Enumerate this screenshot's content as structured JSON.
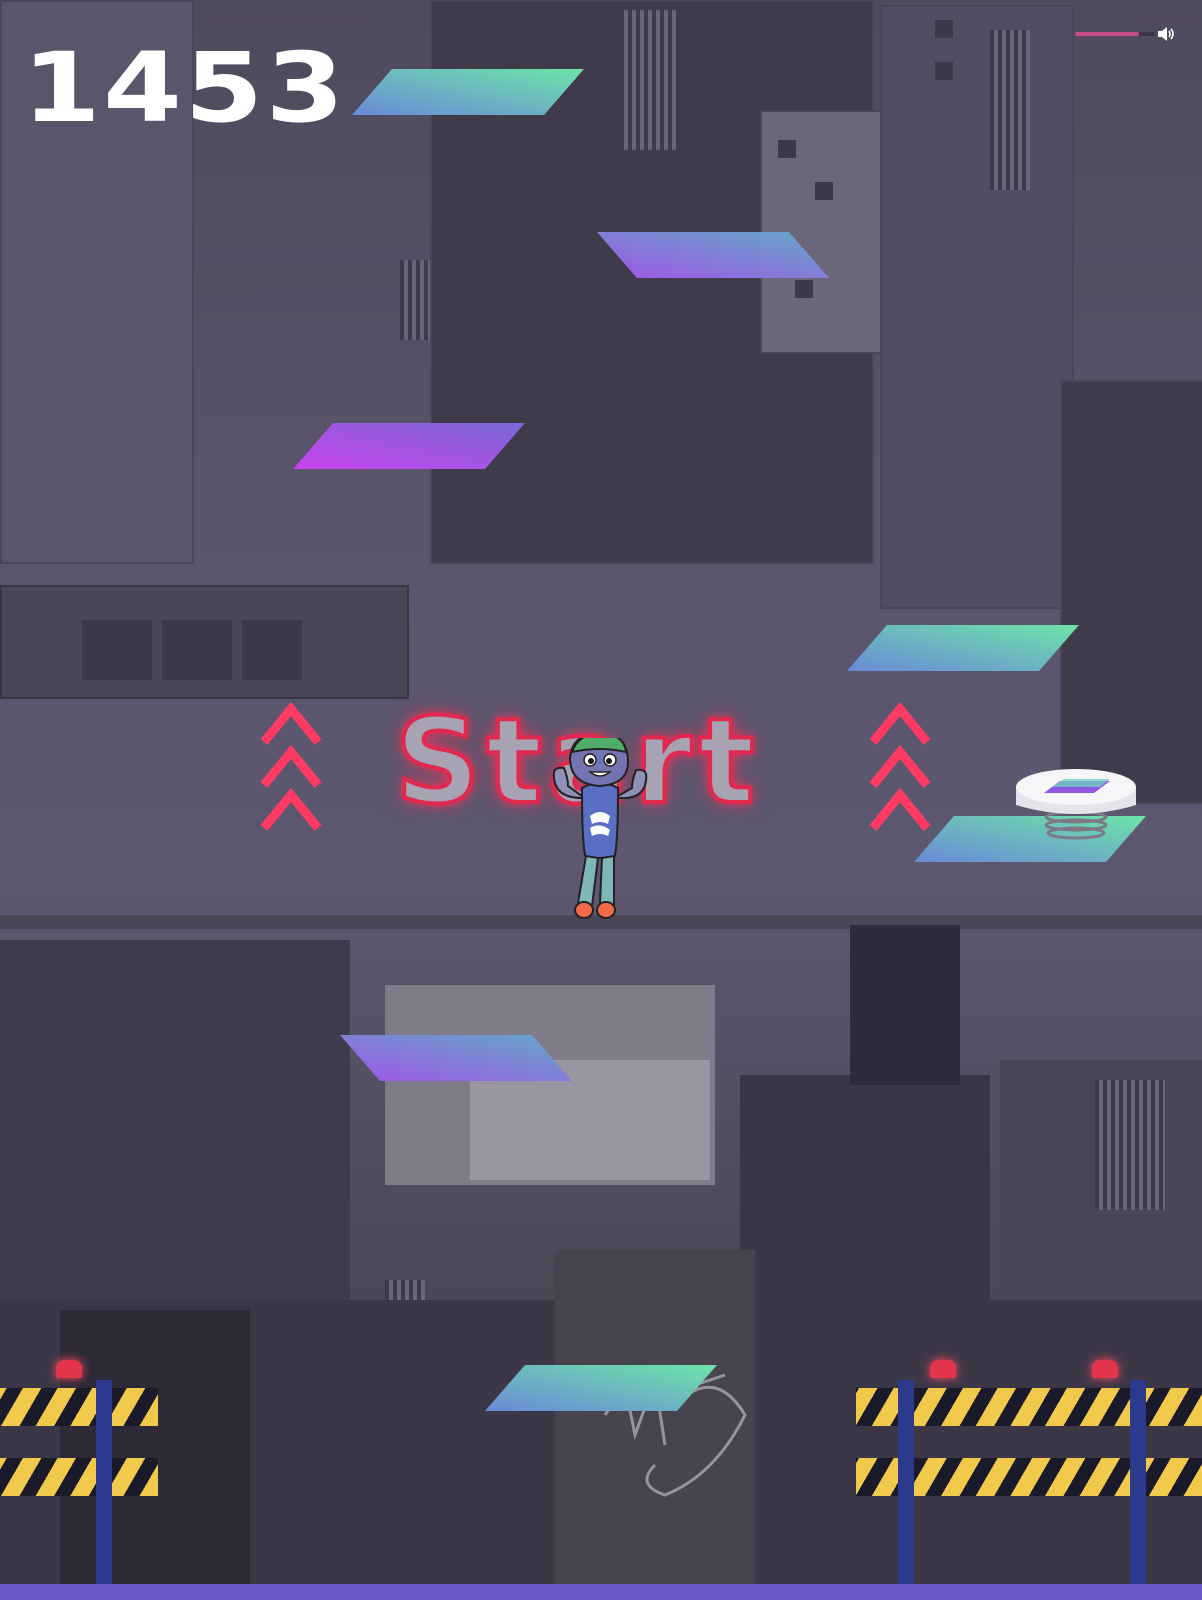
{
  "game": {
    "score": "1453",
    "start_label": "Start"
  },
  "volume": {
    "level": 0.8
  },
  "colors": {
    "platform_teal": "#6de4a8",
    "platform_blue": "#6a8ad8",
    "platform_purple": "#c24ae8",
    "neon_red": "#ff2e5a",
    "volume_fill": "#c74f88"
  },
  "icons": {
    "volume": "speaker-icon",
    "chevrons": "triple-chevron-up-icon"
  },
  "platforms": [
    {
      "id": "p1",
      "variant": "teal-right"
    },
    {
      "id": "p2",
      "variant": "purple-left"
    },
    {
      "id": "p3",
      "variant": "purple-strong"
    },
    {
      "id": "p4",
      "variant": "teal-right"
    },
    {
      "id": "p5",
      "variant": "teal-right"
    },
    {
      "id": "p6",
      "variant": "purple-left"
    },
    {
      "id": "p7",
      "variant": "teal-right"
    }
  ]
}
